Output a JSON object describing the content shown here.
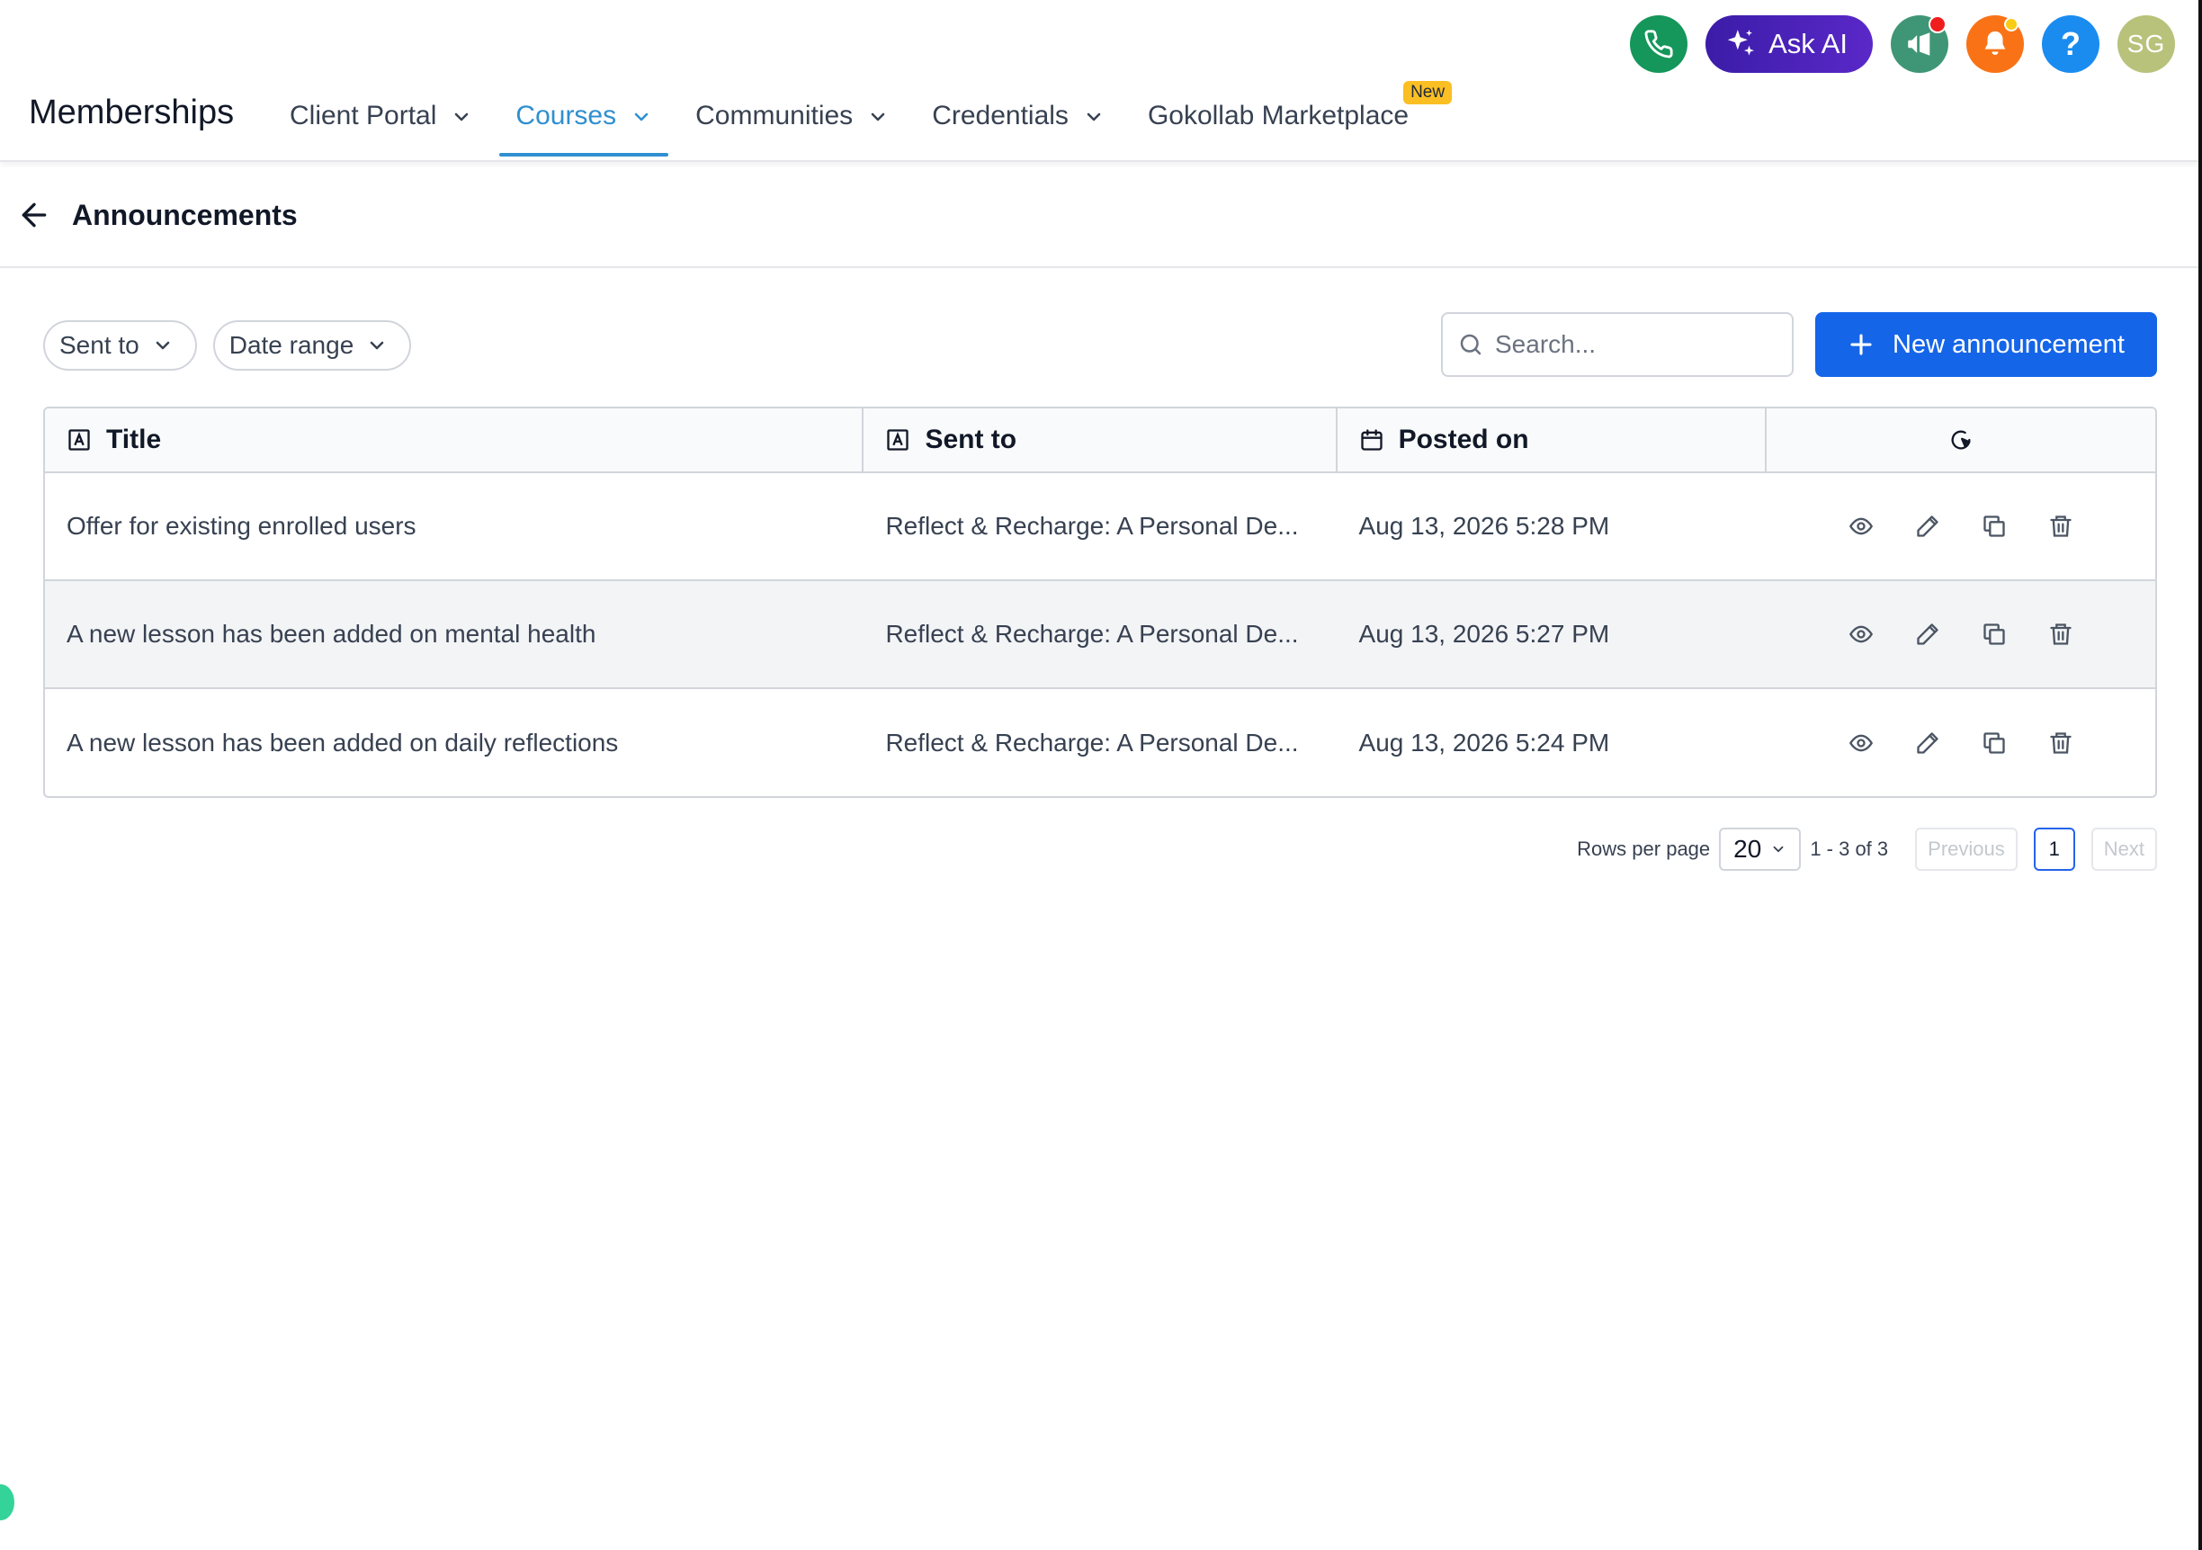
{
  "header": {
    "brand": "Memberships",
    "ask_ai_label": "Ask AI",
    "avatar_initials": "SG",
    "help_label": "?",
    "nav": [
      {
        "label": "Client Portal",
        "has_dropdown": true,
        "active": false
      },
      {
        "label": "Courses",
        "has_dropdown": true,
        "active": true
      },
      {
        "label": "Communities",
        "has_dropdown": true,
        "active": false
      },
      {
        "label": "Credentials",
        "has_dropdown": true,
        "active": false
      },
      {
        "label": "Gokollab Marketplace",
        "has_dropdown": false,
        "active": false,
        "badge": "New"
      }
    ]
  },
  "page": {
    "title": "Announcements"
  },
  "filters": {
    "sent_to_label": "Sent to",
    "date_range_label": "Date range"
  },
  "search": {
    "placeholder": "Search...",
    "value": ""
  },
  "new_button_label": "New announcement",
  "table": {
    "columns": [
      "Title",
      "Sent to",
      "Posted on"
    ],
    "rows": [
      {
        "title": "Offer for existing enrolled users",
        "sent_to": "Reflect & Recharge: A Personal De...",
        "posted_on": "Aug 13, 2026 5:28 PM"
      },
      {
        "title": "A new lesson has been added on mental health",
        "sent_to": "Reflect & Recharge: A Personal De...",
        "posted_on": "Aug 13, 2026 5:27 PM"
      },
      {
        "title": "A new lesson has been added on daily reflections",
        "sent_to": "Reflect & Recharge: A Personal De...",
        "posted_on": "Aug 13, 2026 5:24 PM"
      }
    ]
  },
  "pagination": {
    "rows_per_page_label": "Rows per page",
    "rows_per_page": "20",
    "range": "1 - 3 of 3",
    "previous_label": "Previous",
    "current_page": "1",
    "next_label": "Next"
  },
  "colors": {
    "primary": "#1565e8",
    "nav_active": "#2f8fd0",
    "ask_ai": "#4a22b8",
    "phone": "#15965a",
    "bell": "#f97316",
    "help": "#1a8cf0"
  },
  "icons": {
    "phone": "phone-icon",
    "ask_ai": "sparkles-icon",
    "announce": "megaphone-icon",
    "bell": "bell-icon",
    "back": "arrow-left-icon",
    "search": "search-icon",
    "plus": "plus-icon",
    "column_text": "text-type-icon",
    "column_date": "calendar-icon",
    "column_settings": "refresh-cursor-icon",
    "view": "eye-icon",
    "edit": "pencil-icon",
    "duplicate": "copy-icon",
    "delete": "trash-icon"
  }
}
